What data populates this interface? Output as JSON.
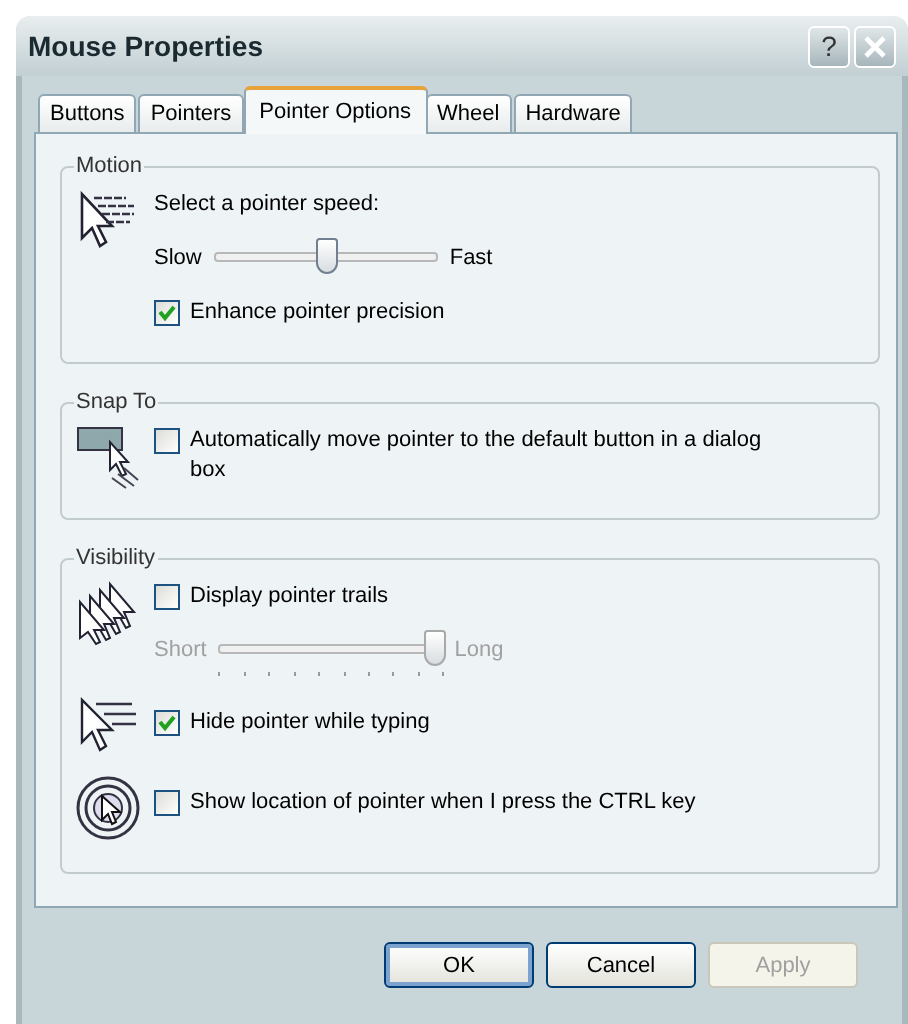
{
  "window": {
    "title": "Mouse Properties",
    "help_button": "?"
  },
  "tabs": [
    {
      "label": "Buttons",
      "selected": false
    },
    {
      "label": "Pointers",
      "selected": false
    },
    {
      "label": "Pointer Options",
      "selected": true
    },
    {
      "label": "Wheel",
      "selected": false
    },
    {
      "label": "Hardware",
      "selected": false
    }
  ],
  "groups": [
    {
      "title": "Motion",
      "rows": [
        {
          "kind": "label",
          "text": "Select a pointer speed:"
        },
        {
          "kind": "slider",
          "min_label": "Slow",
          "max_label": "Fast",
          "level": 0.5,
          "disabled": false,
          "ticks": false
        },
        {
          "kind": "checkbox",
          "label": "Enhance pointer precision",
          "checked": true
        }
      ]
    },
    {
      "title": "Snap To",
      "rows": [
        {
          "kind": "checkbox",
          "label": "Automatically move pointer to the default button in a dialog box",
          "checked": false
        }
      ]
    },
    {
      "title": "Visibility",
      "rows": [
        {
          "kind": "checkbox",
          "label": "Display pointer trails",
          "checked": false
        },
        {
          "kind": "slider",
          "min_label": "Short",
          "max_label": "Long",
          "level": 0.96,
          "disabled": true,
          "ticks": true
        },
        {
          "kind": "checkbox",
          "label": "Hide pointer while typing",
          "checked": true
        },
        {
          "kind": "checkbox",
          "label": "Show location of pointer when I press the CTRL key",
          "checked": false
        }
      ]
    }
  ],
  "buttons": [
    {
      "label": "OK",
      "default": true,
      "disabled": false
    },
    {
      "label": "Cancel",
      "default": false,
      "disabled": false
    },
    {
      "label": "Apply",
      "default": false,
      "disabled": true
    }
  ]
}
